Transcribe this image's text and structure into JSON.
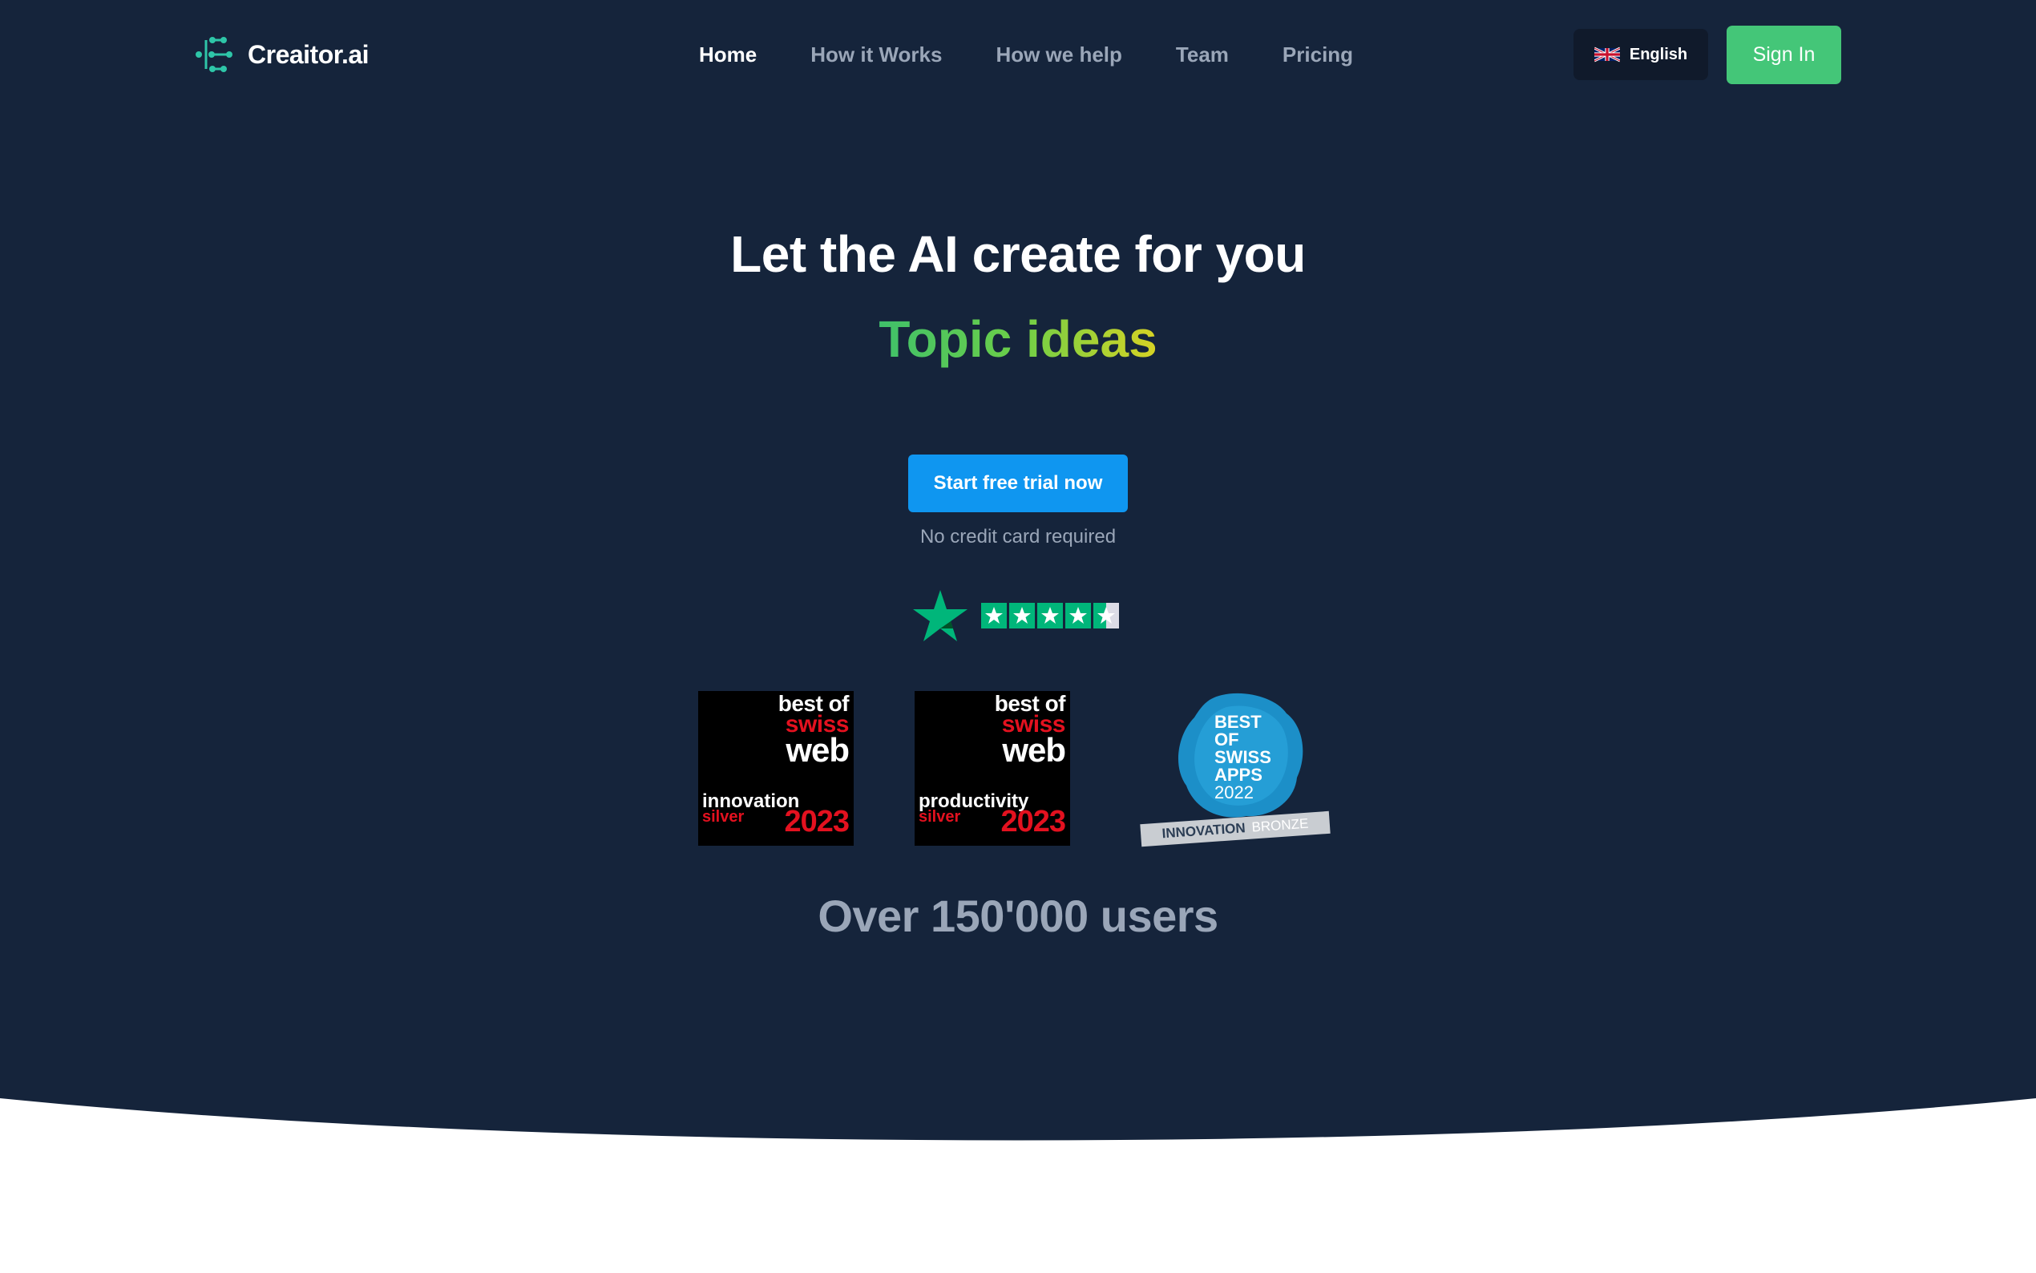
{
  "brand": {
    "name": "Creaitor.ai",
    "accent": "#44c678"
  },
  "nav": {
    "items": [
      {
        "label": "Home",
        "active": true
      },
      {
        "label": "How it Works",
        "active": false
      },
      {
        "label": "How we help",
        "active": false
      },
      {
        "label": "Team",
        "active": false
      },
      {
        "label": "Pricing",
        "active": false
      }
    ],
    "language": {
      "label": "English",
      "flag_icon": "uk-flag-icon"
    },
    "sign_in": "Sign In"
  },
  "hero": {
    "headline": "Let the AI create for you",
    "rotating_word": "Topic ideas",
    "cta": "Start free trial now",
    "note": "No credit card required",
    "rating": {
      "icon": "trustpilot-star-icon",
      "stars": 4.5,
      "out_of": 5
    },
    "users": "Over 150'000 users"
  },
  "badges": [
    {
      "line1": "best of",
      "line2": "swiss",
      "line3": "web",
      "category": "innovation",
      "level": "silver",
      "year": "2023"
    },
    {
      "line1": "best of",
      "line2": "swiss",
      "line3": "web",
      "category": "productivity",
      "level": "silver",
      "year": "2023"
    }
  ],
  "apps_badge": {
    "lines": [
      "BEST",
      "OF",
      "SWISS",
      "APPS",
      "2022"
    ],
    "ribbon_primary": "INNOVATION",
    "ribbon_secondary": "BRONZE"
  },
  "colors": {
    "hero_bg": "#15243b",
    "cta": "#0f96f0",
    "trustpilot": "#00b67a",
    "badge_red": "#e3111f",
    "apps_blue": "#1c8fc8"
  }
}
